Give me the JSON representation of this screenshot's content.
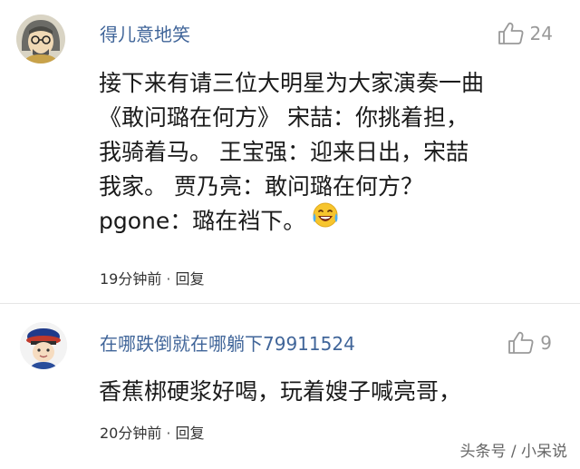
{
  "comments": [
    {
      "username": "得儿意地笑",
      "likes": "24",
      "lines": [
        "接下来有请三位大明星为大家演奏一曲",
        "《敢问璐在何方》  宋喆：你挑着担，",
        "我骑着马。  王宝强：迎来日出，宋喆",
        "我家。  贾乃亮：敢问璐在何方？",
        "pgone：璐在裆下。"
      ],
      "time": "19分钟前",
      "reply": "回复"
    },
    {
      "username": "在哪跌倒就在哪躺下79911524",
      "likes": "9",
      "lines": [
        "香蕉梆硬浆好喝，玩着嫂子喊亮哥，"
      ],
      "time": "20分钟前",
      "reply": "回复"
    }
  ],
  "separator": "·",
  "watermark": "头条号 / 小呆说",
  "icons": {
    "like": "thumbs-up-icon",
    "emoji": "laughing-tears-emoji-icon"
  },
  "colors": {
    "username": "#406599",
    "like": "#999999",
    "text": "#1a1a1a"
  }
}
